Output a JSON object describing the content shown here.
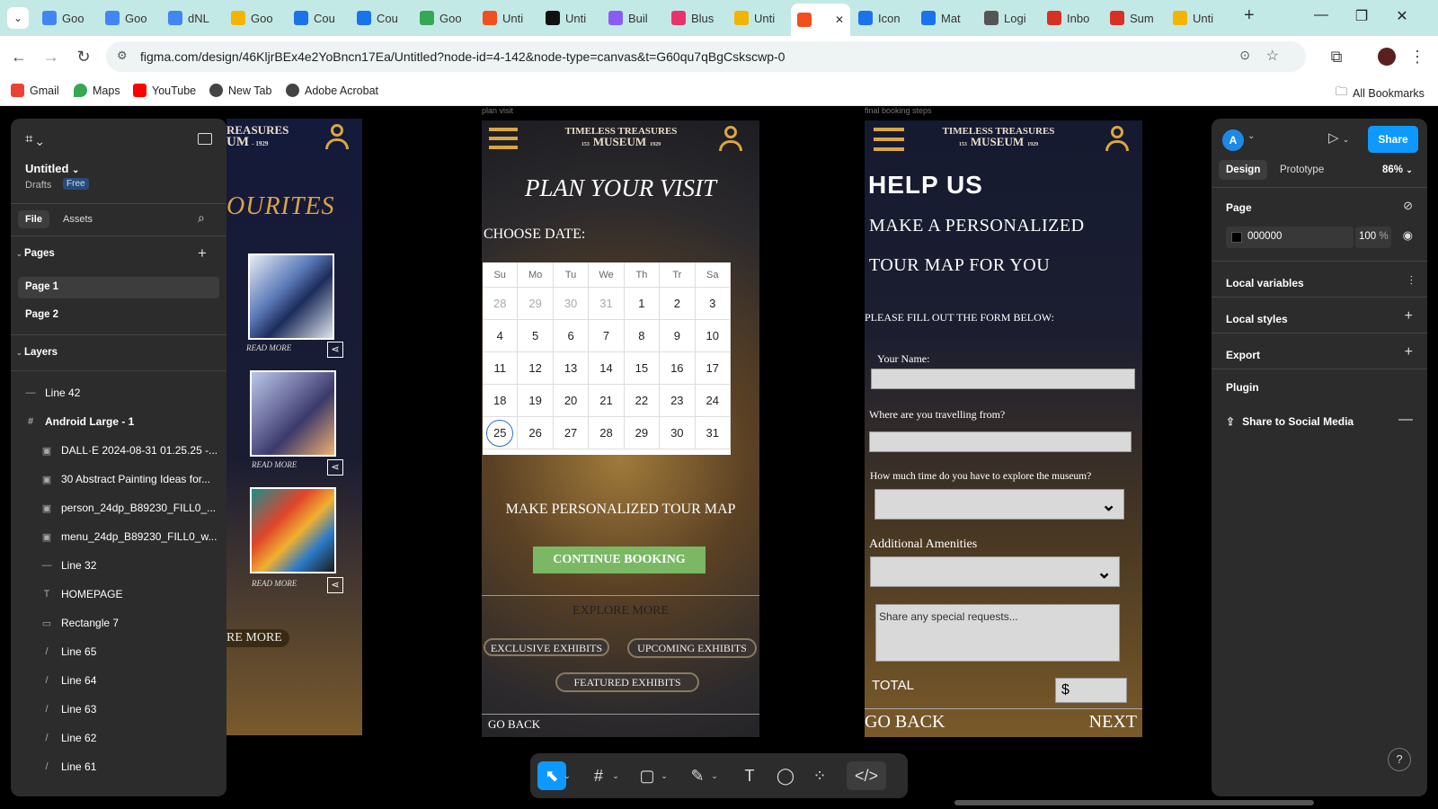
{
  "tabs": [
    {
      "label": "Goo",
      "color": "#4285f4"
    },
    {
      "label": "Goo",
      "color": "#4285f4"
    },
    {
      "label": "dNL",
      "color": "#4285f4"
    },
    {
      "label": "Goo",
      "color": "#f4b400"
    },
    {
      "label": "Cou",
      "color": "#1a73e8"
    },
    {
      "label": "Cou",
      "color": "#1a73e8"
    },
    {
      "label": "Goo",
      "color": "#34a853"
    },
    {
      "label": "Unti",
      "color": "#f24e1e"
    },
    {
      "label": "Unti",
      "color": "#111111"
    },
    {
      "label": "Buil",
      "color": "#8a5cf6"
    },
    {
      "label": "Blus",
      "color": "#e8336d"
    },
    {
      "label": "Unti",
      "color": "#f2b400"
    },
    {
      "label": "",
      "color": "#f24e1e",
      "active": true
    },
    {
      "label": "Icon",
      "color": "#1a73e8"
    },
    {
      "label": "Mat",
      "color": "#1a73e8"
    },
    {
      "label": "Logi",
      "color": "#555555"
    },
    {
      "label": "Inbo",
      "color": "#d93025"
    },
    {
      "label": "Sum",
      "color": "#d93025"
    },
    {
      "label": "Unti",
      "color": "#f4b400"
    }
  ],
  "tab_close": "✕",
  "new_tab": "+",
  "url": "figma.com/design/46KljrBEx4e2YoBncn17Ea/Untitled?node-id=4-142&node-type=canvas&t=G60qu7qBgCskscwp-0",
  "bookmarks": [
    "Gmail",
    "Maps",
    "YouTube",
    "New Tab",
    "Adobe Acrobat"
  ],
  "all_bookmarks": "All Bookmarks",
  "left_panel": {
    "file_name": "Untitled",
    "drafts": "Drafts",
    "plan_badge": "Free",
    "tabs": [
      "File",
      "Assets"
    ],
    "pages_title": "Pages",
    "pages": [
      "Page 1",
      "Page 2"
    ],
    "layers_title": "Layers",
    "layers": [
      {
        "name": "Line 42",
        "icon": "—",
        "indent": 0
      },
      {
        "name": "Android Large - 1",
        "icon": "#",
        "indent": 0,
        "bold": true
      },
      {
        "name": "DALL·E 2024-08-31 01.25.25 -...",
        "icon": "▣",
        "indent": 1
      },
      {
        "name": "30 Abstract Painting Ideas for...",
        "icon": "▣",
        "indent": 1
      },
      {
        "name": "person_24dp_B89230_FILL0_...",
        "icon": "▣",
        "indent": 1
      },
      {
        "name": "menu_24dp_B89230_FILL0_w...",
        "icon": "▣",
        "indent": 1
      },
      {
        "name": "Line 32",
        "icon": "—",
        "indent": 1
      },
      {
        "name": "HOMEPAGE",
        "icon": "T",
        "indent": 1
      },
      {
        "name": "Rectangle 7",
        "icon": "▭",
        "indent": 1
      },
      {
        "name": "Line 65",
        "icon": "/",
        "indent": 1
      },
      {
        "name": "Line 64",
        "icon": "/",
        "indent": 1
      },
      {
        "name": "Line 63",
        "icon": "/",
        "indent": 1
      },
      {
        "name": "Line 62",
        "icon": "/",
        "indent": 1
      },
      {
        "name": "Line 61",
        "icon": "/",
        "indent": 1
      }
    ]
  },
  "right_panel": {
    "avatar": "A",
    "share": "Share",
    "tabs": [
      "Design",
      "Prototype"
    ],
    "zoom": "86%",
    "page_title": "Page",
    "page_color": "000000",
    "page_opacity": "100",
    "percent": "%",
    "sections": [
      "Local variables",
      "Local styles",
      "Export",
      "Plugin"
    ],
    "plugin_item": "Share to Social Media",
    "help": "?"
  },
  "frame_a": {
    "brand_line1": "REASURES",
    "brand_line2": "UM",
    "brand_year": "- 1929",
    "heading": "OURITES",
    "read_more": [
      "READ MORE",
      "READ MORE",
      "READ MORE"
    ],
    "explore_more": "RE MORE"
  },
  "frame_b": {
    "label_above": "plan visit",
    "brand_line1": "TIMELESS TREASURES",
    "brand_line2": "MUSEUM",
    "brand_year_left": "153",
    "brand_year_right": "1929",
    "title": "PLAN YOUR VISIT",
    "choose_date": "CHOOSE DATE:",
    "weekdays": [
      "Su",
      "Mo",
      "Tu",
      "We",
      "Th",
      "Tr",
      "Sa"
    ],
    "weeks": [
      [
        "28",
        "29",
        "30",
        "31",
        "1",
        "2",
        "3"
      ],
      [
        "4",
        "5",
        "6",
        "7",
        "8",
        "9",
        "10"
      ],
      [
        "11",
        "12",
        "13",
        "14",
        "15",
        "16",
        "17"
      ],
      [
        "18",
        "19",
        "20",
        "21",
        "22",
        "23",
        "24"
      ],
      [
        "25",
        "26",
        "27",
        "28",
        "29",
        "30",
        "31"
      ]
    ],
    "make_map": "MAKE PERSONALIZED TOUR MAP",
    "continue_btn": "CONTINUE BOOKING",
    "explore_more": "EXPLORE MORE",
    "pill_exclusive": "EXCLUSIVE EXHIBITS",
    "pill_upcoming": "UPCOMING EXHIBITS",
    "pill_featured": "FEATURED EXHIBITS",
    "go_back": "GO BACK"
  },
  "frame_c": {
    "label_above": "final booking steps",
    "brand_line1": "TIMELESS TREASURES",
    "brand_line2": "MUSEUM",
    "brand_year_left": "153",
    "brand_year_right": "1929",
    "help_us": "HELP US",
    "make_line1": "MAKE A PERSONALIZED",
    "make_line2": "TOUR MAP FOR YOU",
    "fill_form": "PLEASE FILL OUT THE FORM BELOW:",
    "your_name": "Your Name:",
    "travelling": "Where are you travelling from?",
    "time": "How much time do you have to explore the museum?",
    "amenities": "Additional Amenities",
    "requests_placeholder": "Share any special requests...",
    "total": "TOTAL",
    "currency": "$",
    "go_back": "GO BACK",
    "next": "NEXT"
  },
  "colors": {
    "accent": "#0d99ff",
    "museum_gold": "#d9a642",
    "continue_green": "#7ab864"
  }
}
